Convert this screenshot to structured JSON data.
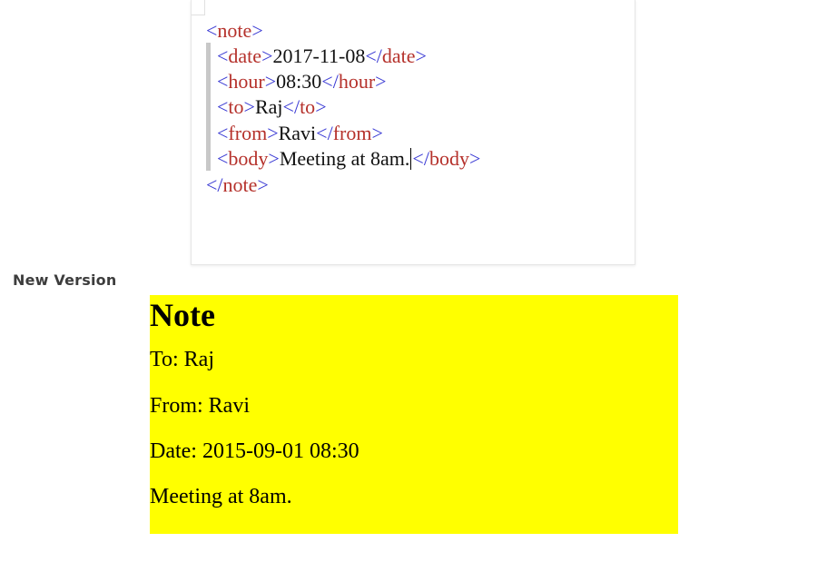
{
  "editor": {
    "lines": [
      {
        "open": "<",
        "tag": "note",
        "close": ">"
      },
      {
        "tag_open": "<date>",
        "value": "2017-11-08",
        "tag_close": "</date>"
      },
      {
        "tag_open": "<hour>",
        "value": "08:30",
        "tag_close": "</hour>"
      },
      {
        "tag_open": "<to>",
        "value": "Raj",
        "tag_close": "</to>"
      },
      {
        "tag_open": "<from>",
        "value": "Ravi",
        "tag_close": "</from>"
      },
      {
        "tag_open": "<body>",
        "value": "Meeting at 8am.",
        "tag_close": "</body>"
      },
      {
        "open": "</",
        "tag": "note",
        "close": ">"
      }
    ],
    "colors": {
      "bracket": "#3a3ad4",
      "tag_name": "#b5312b",
      "text": "#111111"
    }
  },
  "section_label": "New Version",
  "preview": {
    "title": "Note",
    "to": "To: Raj",
    "from": "From: Ravi",
    "date": "Date: 2015-09-01 08:30",
    "body": "Meeting at 8am.",
    "background": "#ffff00"
  }
}
